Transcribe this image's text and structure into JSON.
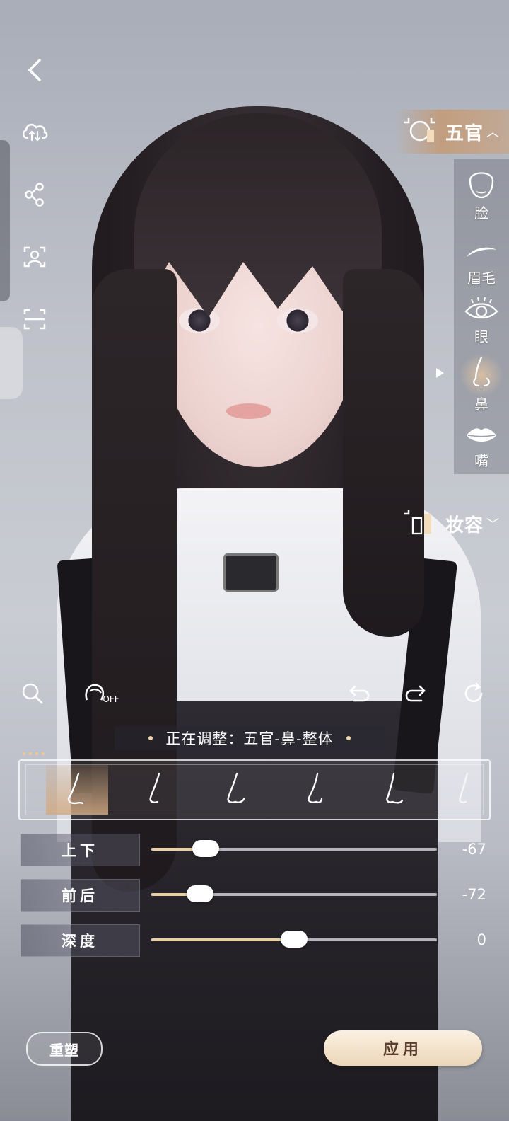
{
  "top_left_buttons": [
    "back-icon",
    "cloud-sync-icon",
    "share-icon",
    "face-scan-icon",
    "scan-frame-icon"
  ],
  "right_panel": {
    "category": "五官",
    "subcategories": [
      {
        "label": "脸",
        "icon": "face-outline-icon"
      },
      {
        "label": "眉毛",
        "icon": "eyebrow-icon"
      },
      {
        "label": "眼",
        "icon": "eye-icon"
      },
      {
        "label": "鼻",
        "icon": "nose-icon",
        "active": true
      },
      {
        "label": "嘴",
        "icon": "lips-icon"
      }
    ],
    "makeup_category": "妆容"
  },
  "toolbar": {
    "search": "search-icon",
    "hair_toggle": "hair-toggle-icon",
    "hair_toggle_state": "OFF",
    "undo": "undo-icon",
    "redo": "redo-icon",
    "reset_view": "refresh-icon"
  },
  "status": {
    "text": "正在调整：五官-鼻-整体"
  },
  "presets": {
    "count_visible": 6,
    "selected_index": 0
  },
  "sliders": [
    {
      "label": "上下",
      "value": -67,
      "display": "-67",
      "fraction": 0.19
    },
    {
      "label": "前后",
      "value": -72,
      "display": "-72",
      "fraction": 0.17
    },
    {
      "label": "深度",
      "value": 0,
      "display": "0",
      "fraction": 0.5
    }
  ],
  "buttons": {
    "reset": "重塑",
    "apply": "应用"
  },
  "colors": {
    "accent": "#e9cfa6",
    "apply_bg": "#f4e4cd",
    "header_bg": "#c9966a"
  }
}
